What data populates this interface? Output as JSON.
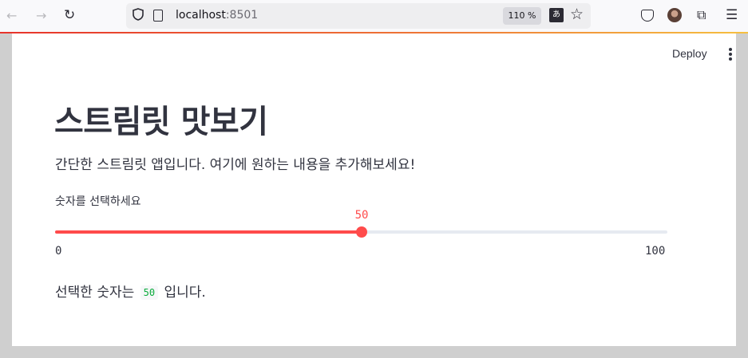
{
  "browser": {
    "url_host": "localhost",
    "url_port": ":8501",
    "zoom_level": "110 %",
    "back_icon": "arrow-left-icon",
    "forward_icon": "arrow-right-icon",
    "reload_icon": "reload-icon"
  },
  "toolbar": {
    "deploy_label": "Deploy",
    "menu_icon": "kebab-menu-icon"
  },
  "main": {
    "title": "스트림릿 맛보기",
    "description": "간단한 스트림릿 앱입니다. 여기에 원하는 내용을 추가해보세요!",
    "slider": {
      "label": "숫자를 선택하세요",
      "value": 50,
      "value_text": "50",
      "min": 0,
      "max": 100,
      "min_text": "0",
      "max_text": "100",
      "accent_color": "#ff4b4b"
    },
    "result": {
      "prefix": "선택한 숫자는",
      "value": "50",
      "suffix": "입니다."
    }
  }
}
